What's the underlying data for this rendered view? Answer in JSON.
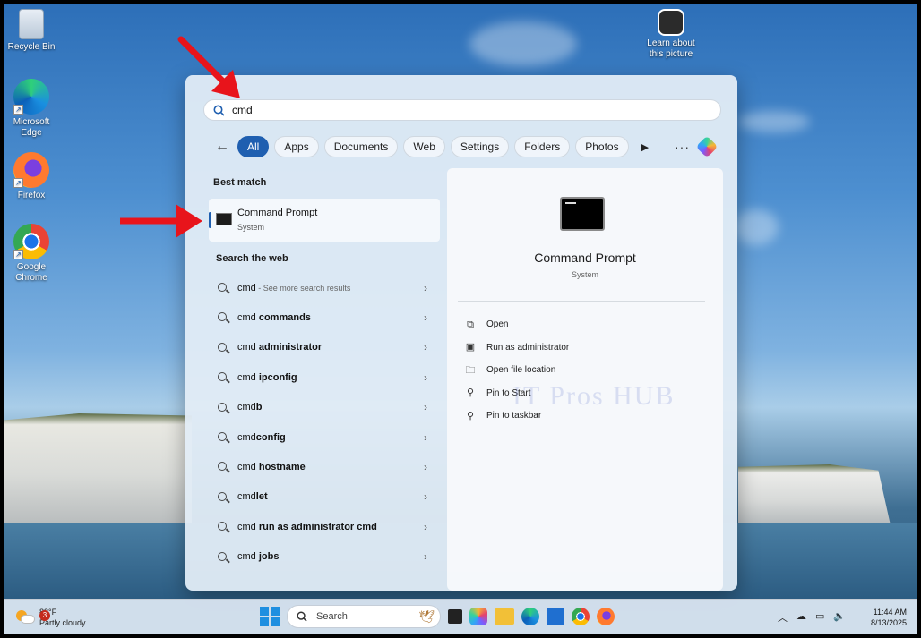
{
  "desktop": {
    "icons": [
      {
        "label": "Recycle Bin",
        "icon": "recycle-bin-icon"
      },
      {
        "label": "Microsoft Edge",
        "icon": "edge-icon"
      },
      {
        "label": "Firefox",
        "icon": "firefox-icon"
      },
      {
        "label": "Google Chrome",
        "icon": "chrome-icon"
      }
    ],
    "spotlight": {
      "label": "Learn about this picture",
      "icon": "spotlight-icon"
    }
  },
  "start_search": {
    "query": "cmd",
    "filters": [
      "All",
      "Apps",
      "Documents",
      "Web",
      "Settings",
      "Folders",
      "Photos"
    ],
    "active_filter": "All",
    "best_match_heading": "Best match",
    "best_match": {
      "name": "Command Prompt",
      "type": "System"
    },
    "web_heading": "Search the web",
    "web_results": [
      {
        "prefix": "cmd",
        "bold": "",
        "hint": " - See more search results"
      },
      {
        "prefix": "cmd ",
        "bold": "commands",
        "hint": ""
      },
      {
        "prefix": "cmd ",
        "bold": "administrator",
        "hint": ""
      },
      {
        "prefix": "cmd ",
        "bold": "ipconfig",
        "hint": ""
      },
      {
        "prefix": "cmd",
        "bold": "b",
        "hint": ""
      },
      {
        "prefix": "cmd",
        "bold": "config",
        "hint": ""
      },
      {
        "prefix": "cmd ",
        "bold": "hostname",
        "hint": ""
      },
      {
        "prefix": "cmd",
        "bold": "let",
        "hint": ""
      },
      {
        "prefix": "cmd ",
        "bold": "run as administrator cmd",
        "hint": ""
      },
      {
        "prefix": "cmd ",
        "bold": "jobs",
        "hint": ""
      }
    ],
    "detail": {
      "title": "Command Prompt",
      "subtitle": "System",
      "actions": [
        {
          "label": "Open",
          "icon": "open-external-icon"
        },
        {
          "label": "Run as administrator",
          "icon": "shield-icon"
        },
        {
          "label": "Open file location",
          "icon": "folder-icon"
        },
        {
          "label": "Pin to Start",
          "icon": "pin-icon"
        },
        {
          "label": "Pin to taskbar",
          "icon": "pin-icon"
        }
      ]
    },
    "watermark": "IT Pros HUB"
  },
  "taskbar": {
    "weather": {
      "temp": "88°F",
      "condition": "Partly cloudy",
      "badge": "3"
    },
    "search_placeholder": "Search",
    "time": "11:44 AM",
    "date": "8/13/2025"
  },
  "colors": {
    "accent": "#1f5fb0",
    "annotation_arrow": "#e8141b"
  }
}
